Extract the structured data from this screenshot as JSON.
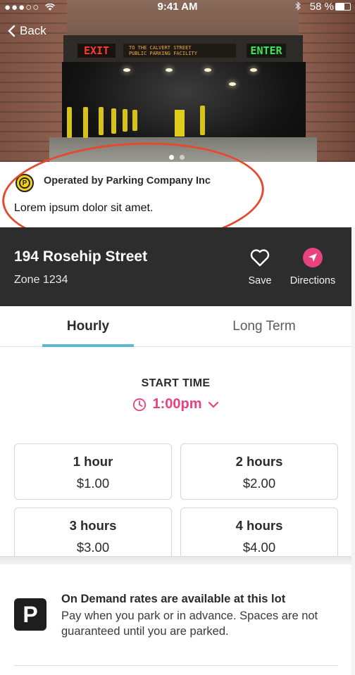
{
  "status_bar": {
    "signal": "●●●○○",
    "time": "9:41 AM",
    "battery": "58 %",
    "battery_level": 0.58
  },
  "nav": {
    "back_label": "Back"
  },
  "hero": {
    "sign_exit": "EXIT",
    "sign_mid_line1": "TO THE CALVERT STREET",
    "sign_mid_line2": "PUBLIC PARKING FACILITY",
    "sign_enter": "ENTER",
    "carousel_count": 2,
    "carousel_active": 1
  },
  "operator": {
    "logo_letter": "P",
    "name": "Operated by Parking Company Inc",
    "description": "Lorem ipsum dolor sit amet."
  },
  "location": {
    "address": "194 Rosehip Street",
    "zone": "Zone 1234",
    "save_label": "Save",
    "directions_label": "Directions"
  },
  "tabs": [
    {
      "label": "Hourly",
      "active": true
    },
    {
      "label": "Long Term",
      "active": false
    }
  ],
  "start": {
    "label": "START TIME",
    "time": "1:00pm"
  },
  "rates": [
    {
      "duration": "1 hour",
      "price": "$1.00"
    },
    {
      "duration": "2 hours",
      "price": "$2.00"
    },
    {
      "duration": "3 hours",
      "price": "$3.00"
    },
    {
      "duration": "4 hours",
      "price": "$4.00"
    }
  ],
  "on_demand": {
    "badge": "P",
    "title": "On Demand rates are available at this lot",
    "text": "Pay when you park or in advance. Spaces are not guaranteed until you are parked."
  },
  "colors": {
    "accent_pink": "#e8427f",
    "tab_underline": "#5ab8d8",
    "dark_bar": "#2d2d2d",
    "highlight_ring": "#e64a2e"
  }
}
